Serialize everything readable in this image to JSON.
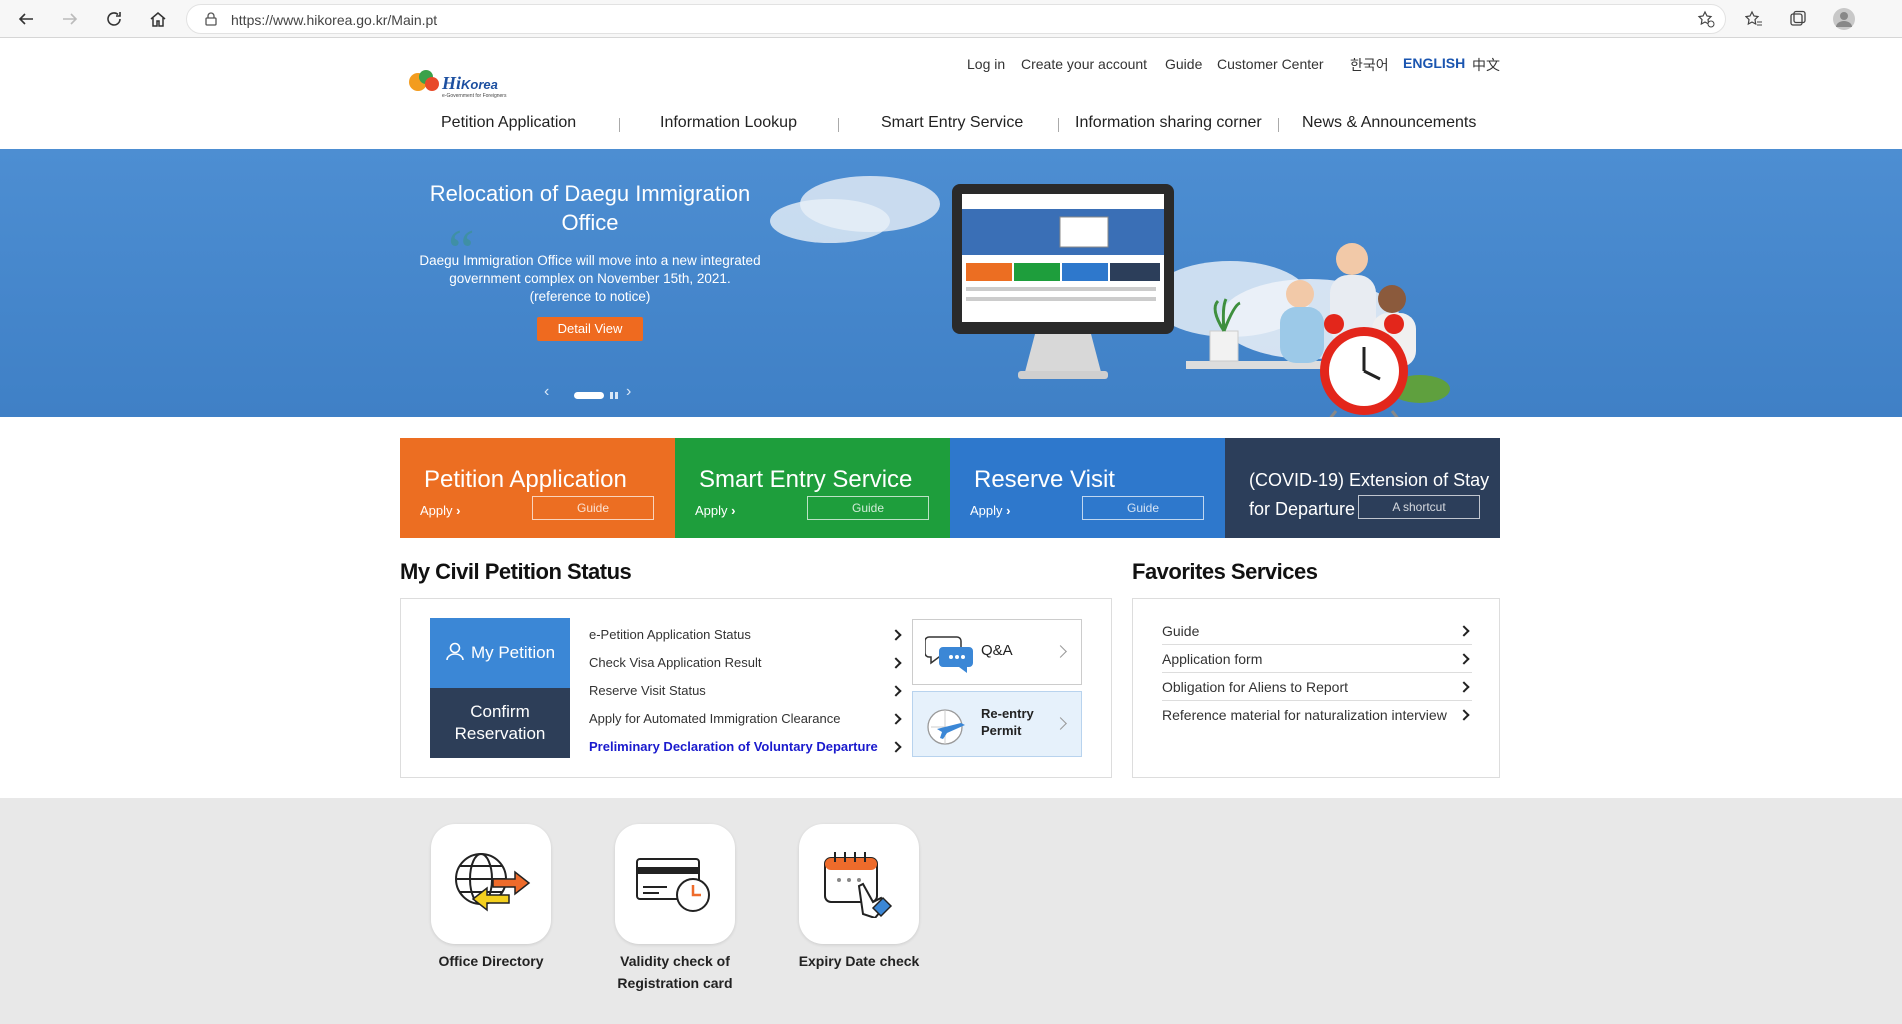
{
  "browser": {
    "url": "https://www.hikorea.go.kr/Main.pt"
  },
  "header": {
    "logo_text": "Hi Korea",
    "logo_subtext": "e-Government for Foreigners",
    "util": [
      "Log in",
      "Create your account",
      "Guide",
      "Customer Center"
    ],
    "languages": [
      "한국어",
      "ENGLISH",
      "中文"
    ],
    "active_language": "ENGLISH",
    "gnb": [
      "Petition Application",
      "Information Lookup",
      "Smart Entry Service",
      "Information sharing corner",
      "News & Announcements"
    ]
  },
  "hero": {
    "title": "Relocation of Daegu Immigration Office",
    "description": "Daegu Immigration Office will move into a new integrated government complex on November 15th, 2021. (reference to notice)",
    "button": "Detail View",
    "prev_icon": "‹",
    "next_icon": "›"
  },
  "tiles": [
    {
      "title": "Petition Application",
      "apply": "Apply",
      "guide": "Guide",
      "color": "#ec6e22"
    },
    {
      "title": "Smart Entry Service",
      "apply": "Apply",
      "guide": "Guide",
      "color": "#1e9e3c"
    },
    {
      "title": "Reserve Visit",
      "apply": "Apply",
      "guide": "Guide",
      "color": "#2e78cc"
    },
    {
      "title_line1": "(COVID-19) Extension of Stay",
      "title_line2": "for Departure",
      "shortcut": "A shortcut",
      "color": "#2c3e5a"
    }
  ],
  "petition": {
    "section_title": "My Civil Petition Status",
    "my_petition": "My Petition",
    "confirm_line1": "Confirm",
    "confirm_line2": "Reservation",
    "links": [
      "e-Petition Application Status",
      "Check Visa Application Result",
      "Reserve Visit Status",
      "Apply for Automated Immigration Clearance",
      "Preliminary Declaration of Voluntary Departure"
    ],
    "qa": "Q&A",
    "reentry_line1": "Re-entry",
    "reentry_line2": "Permit"
  },
  "favorites": {
    "section_title": "Favorites Services",
    "items": [
      "Guide",
      "Application form",
      "Obligation for Aliens to Report",
      "Reference material for naturalization interview"
    ]
  },
  "bottom": {
    "items": [
      {
        "line1": "Office Directory",
        "line2": ""
      },
      {
        "line1": "Validity check of",
        "line2": "Registration card"
      },
      {
        "line1": "Expiry Date check",
        "line2": ""
      }
    ]
  }
}
